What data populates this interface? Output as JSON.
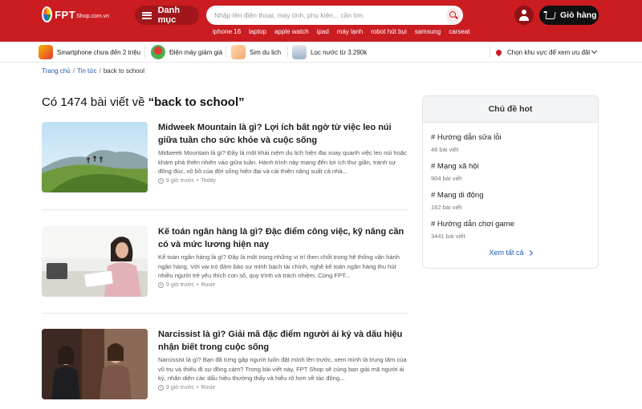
{
  "header": {
    "logo_text": "FPT",
    "logo_sub": "Shop.com.vn",
    "category_label": "Danh mục",
    "search_placeholder": "Nhập tên điện thoại, máy tính, phụ kiện... cần tìm",
    "quick_links": [
      "iphone 16",
      "laptop",
      "apple watch",
      "ipad",
      "máy lạnh",
      "robot hút bụi",
      "samsung",
      "carseat"
    ],
    "cart_label": "Giỏ hàng"
  },
  "promo": {
    "items": [
      "Smartphone chưa đến 2 triệu",
      "Điện máy giảm giá",
      "Sim du lịch",
      "Lọc nước từ 3.290k"
    ],
    "region_label": "Chọn khu vực để xem ưu đãi"
  },
  "breadcrumb": {
    "home": "Trang chủ",
    "news": "Tin tức",
    "current": "back to school"
  },
  "page": {
    "title_prefix": "Có 1474 bài viết về",
    "title_query": "“back to school”"
  },
  "articles": [
    {
      "title": "Midweek Mountain là gì? Lợi ích bất ngờ từ việc leo núi giữa tuần cho sức khỏe và cuộc sống",
      "excerpt": "Midweek Mountain là gì? Đây là một khái niệm du lịch hiện đại xoay quanh việc leo núi hoặc khám phá thiên nhiên vào giữa tuần. Hành trình này mang đến lợi ích thư giãn, tránh sự đông đúc, xô bồ của đời sống hiện đại và cải thiện năng suất cả nhà...",
      "time": "9 giờ trước",
      "author": "Teddy"
    },
    {
      "title": "Kế toán ngân hàng là gì? Đặc điểm công việc, kỹ năng cần có và mức lương hiện nay",
      "excerpt": "Kế toán ngân hàng là gì? Đây là một trong những vị trí then chốt trong hệ thống vận hành ngân hàng. Với vai trò đảm bảo sự minh bạch tài chính, nghề kế toán ngân hàng thu hút nhiều người trẻ yêu thích con số, quy trình và trách nhiệm. Cùng FPT...",
      "time": "9 giờ trước",
      "author": "Rosie"
    },
    {
      "title": "Narcissist là gì? Giải mã đặc điểm người ái kỷ và dấu hiệu nhận biết trong cuộc sống",
      "excerpt": "Narcissist là gì? Bạn đã từng gặp người luôn đặt mình lên trước, xem mình là trung tâm của vũ trụ và thiếu đi sự đồng cảm? Trong bài viết này, FPT Shop sẽ cùng bạn giải mã người ái kỷ, nhận diện các dấu hiệu thường thấy và hiểu rõ hơn về tác động...",
      "time": "9 giờ trước",
      "author": "Rosie"
    }
  ],
  "sidebar": {
    "title": "Chủ đề hot",
    "topics": [
      {
        "name": "# Hướng dẫn sửa lỗi",
        "count": "48 bài viết"
      },
      {
        "name": "# Mạng xã hội",
        "count": "904 bài viết"
      },
      {
        "name": "# Mạng di động",
        "count": "162 bài viết"
      },
      {
        "name": "# Hướng dẫn chơi game",
        "count": "3441 bài viết"
      }
    ],
    "see_all": "Xem tất cả"
  }
}
